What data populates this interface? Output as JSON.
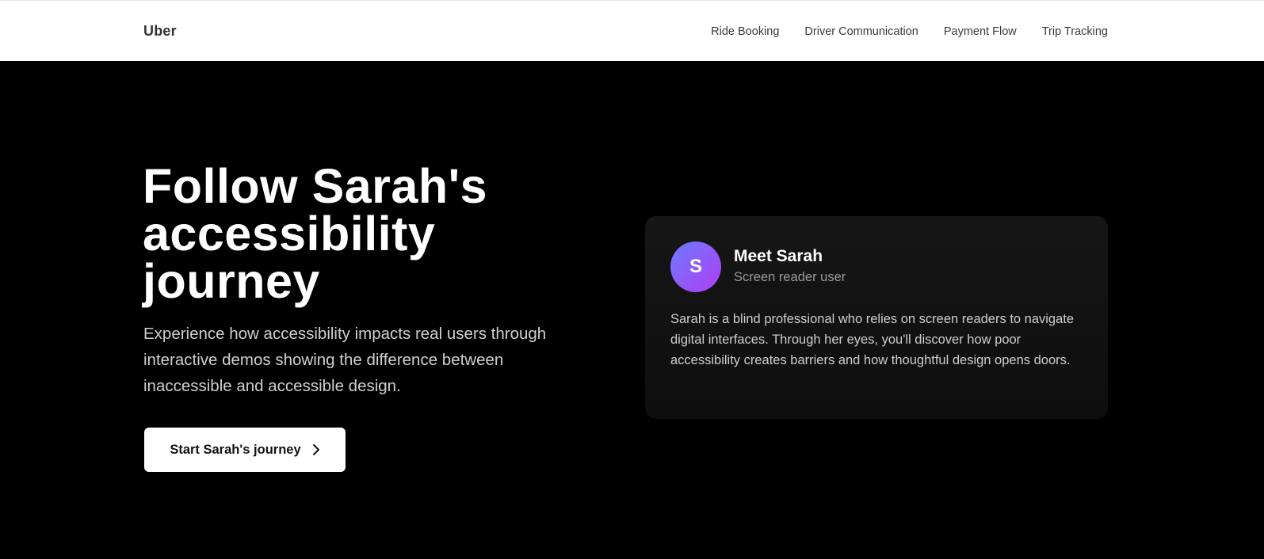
{
  "header": {
    "brand": "Uber",
    "nav": [
      {
        "label": "Ride Booking"
      },
      {
        "label": "Driver Communication"
      },
      {
        "label": "Payment Flow"
      },
      {
        "label": "Trip Tracking"
      }
    ]
  },
  "hero": {
    "title_lines": [
      "Follow Sarah's",
      "accessibility",
      "journey"
    ],
    "subtitle": "Experience how accessibility impacts real users through interactive demos showing the difference between inaccessible and accessible design.",
    "cta_label": "Start Sarah's journey",
    "cta_icon": "chevron-right-icon"
  },
  "profile_card": {
    "avatar_initial": "S",
    "name": "Meet Sarah",
    "role": "Screen reader user",
    "description": "Sarah is a blind professional who relies on screen readers to navigate digital interfaces. Through her eyes, you'll discover how poor accessibility creates barriers and how thoughtful design opens doors."
  },
  "colors": {
    "header_bg": "#ffffff",
    "hero_bg": "#000000",
    "card_bg": "#141414",
    "avatar_gradient_start": "#6b7cff",
    "avatar_gradient_end": "#b13cf2",
    "cta_bg": "#ffffff"
  }
}
